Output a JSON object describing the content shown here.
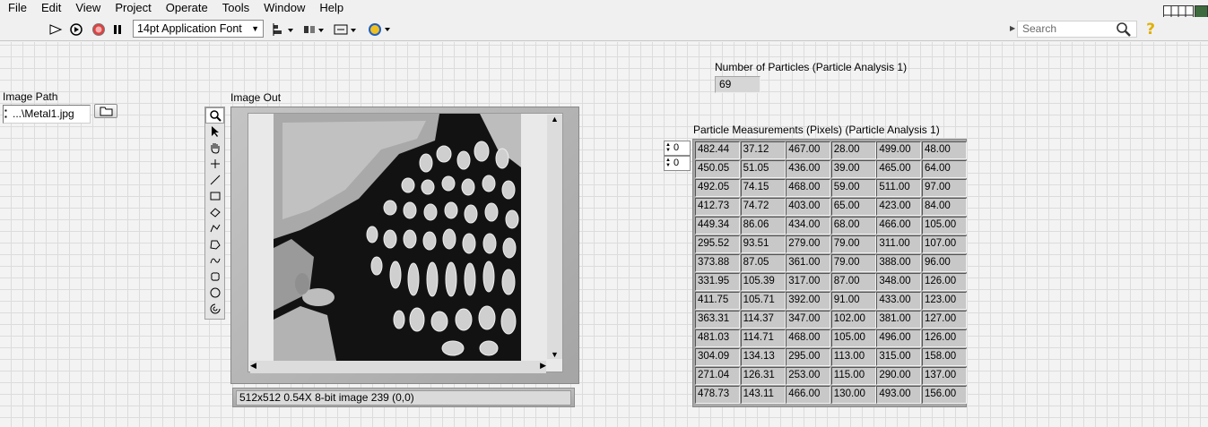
{
  "menu": [
    "File",
    "Edit",
    "View",
    "Project",
    "Operate",
    "Tools",
    "Window",
    "Help"
  ],
  "toolbar": {
    "font": "14pt Application Font",
    "search_placeholder": "Search",
    "icons": [
      "run-arrow-icon",
      "run-continuously-icon",
      "abort-icon",
      "pause-icon",
      "align-icon",
      "distribute-icon",
      "resize-icon",
      "reorder-icon",
      "help-icon"
    ]
  },
  "image_path": {
    "label": "Image Path",
    "value": "...\\Metal1.jpg"
  },
  "image_out": {
    "label": "Image Out",
    "status": "512x512 0.54X 8-bit image 239    (0,0)",
    "tools": [
      "zoom-icon",
      "pointer-icon",
      "pan-icon",
      "point-icon",
      "line-icon",
      "rectangle-icon",
      "rotated-rect-icon",
      "polyline-icon",
      "polygon-icon",
      "freehand-line-icon",
      "freehand-region-icon",
      "oval-icon",
      "annulus-icon"
    ]
  },
  "particle_count": {
    "label": "Number of Particles (Particle Analysis 1)",
    "value": "69"
  },
  "measurements": {
    "label": "Particle Measurements (Pixels) (Particle Analysis 1)",
    "index_row": "0",
    "index_col": "0",
    "rows": [
      [
        "482.44",
        "37.12",
        "467.00",
        "28.00",
        "499.00",
        "48.00"
      ],
      [
        "450.05",
        "51.05",
        "436.00",
        "39.00",
        "465.00",
        "64.00"
      ],
      [
        "492.05",
        "74.15",
        "468.00",
        "59.00",
        "511.00",
        "97.00"
      ],
      [
        "412.73",
        "74.72",
        "403.00",
        "65.00",
        "423.00",
        "84.00"
      ],
      [
        "449.34",
        "86.06",
        "434.00",
        "68.00",
        "466.00",
        "105.00"
      ],
      [
        "295.52",
        "93.51",
        "279.00",
        "79.00",
        "311.00",
        "107.00"
      ],
      [
        "373.88",
        "87.05",
        "361.00",
        "79.00",
        "388.00",
        "96.00"
      ],
      [
        "331.95",
        "105.39",
        "317.00",
        "87.00",
        "348.00",
        "126.00"
      ],
      [
        "411.75",
        "105.71",
        "392.00",
        "91.00",
        "433.00",
        "123.00"
      ],
      [
        "363.31",
        "114.37",
        "347.00",
        "102.00",
        "381.00",
        "127.00"
      ],
      [
        "481.03",
        "114.71",
        "468.00",
        "105.00",
        "496.00",
        "126.00"
      ],
      [
        "304.09",
        "134.13",
        "295.00",
        "113.00",
        "315.00",
        "158.00"
      ],
      [
        "271.04",
        "126.31",
        "253.00",
        "115.00",
        "290.00",
        "137.00"
      ],
      [
        "478.73",
        "143.11",
        "466.00",
        "130.00",
        "493.00",
        "156.00"
      ]
    ]
  }
}
